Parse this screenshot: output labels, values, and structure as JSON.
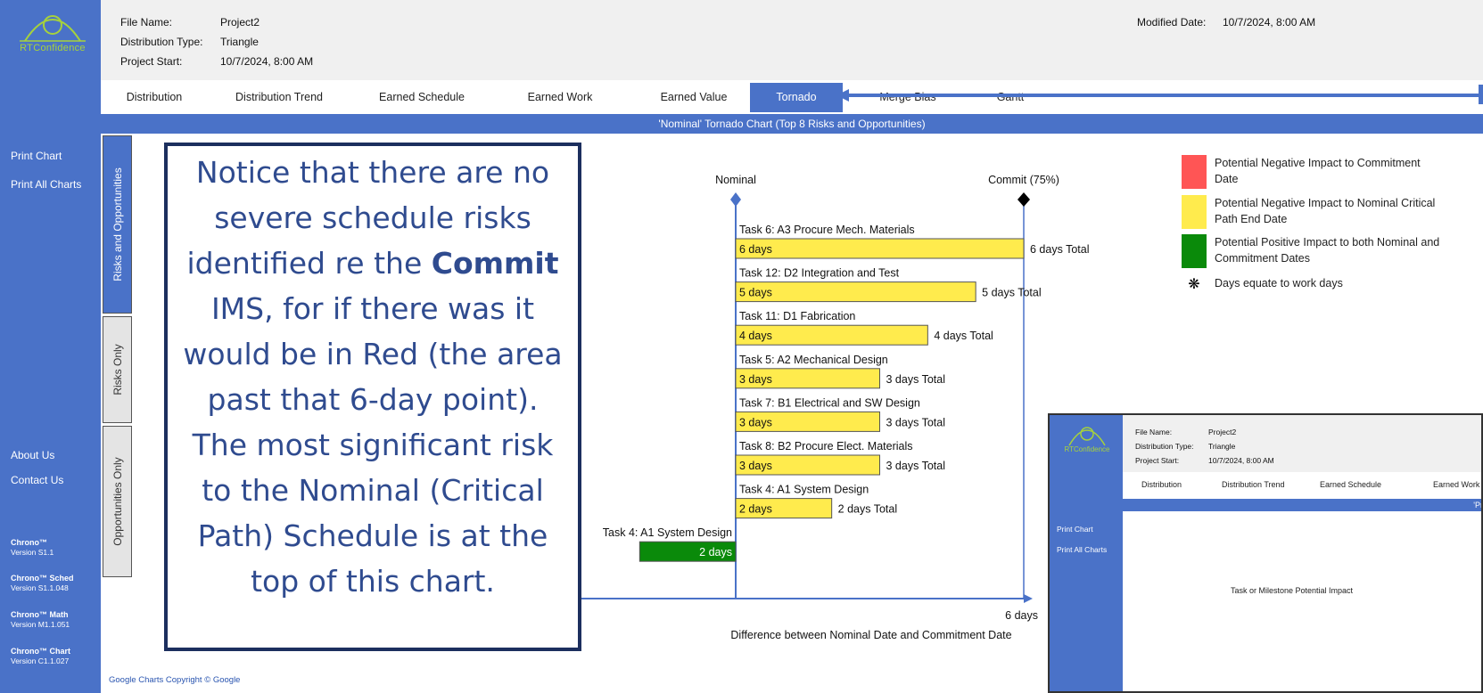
{
  "app": {
    "logo_text": "RTConfidence"
  },
  "sidebar": {
    "links": [
      "Print Chart",
      "Print All Charts",
      "About Us",
      "Contact Us"
    ],
    "versions": [
      {
        "name": "Chrono™",
        "version": "Version S1.1"
      },
      {
        "name": "Chrono™ Sched",
        "version": "Version S1.1.048"
      },
      {
        "name": "Chrono™ Math",
        "version": "Version M1.1.051"
      },
      {
        "name": "Chrono™ Chart",
        "version": "Version C1.1.027"
      }
    ]
  },
  "info": {
    "file_name_label": "File Name:",
    "file_name": "Project2",
    "dist_type_label": "Distribution Type:",
    "dist_type": "Triangle",
    "project_start_label": "Project Start:",
    "project_start": "10/7/2024, 8:00 AM",
    "modified_label": "Modified Date:",
    "modified": "10/7/2024, 8:00 AM"
  },
  "tabs": [
    "Distribution",
    "Distribution Trend",
    "Earned Schedule",
    "Earned Work",
    "Earned Value",
    "Tornado",
    "Merge Bias",
    "Gantt"
  ],
  "active_tab": "Tornado",
  "chart_title": "'Nominal' Tornado Chart (Top 8 Risks and Opportunities)",
  "vertical_tabs": [
    "Risks and Opportunities",
    "Risks Only",
    "Opportunities Only"
  ],
  "colors": {
    "accent": "#4a72c8",
    "negative_commit": "#ff5555",
    "negative_nominal": "#ffeb4d",
    "positive": "#0a8a0a"
  },
  "legend": [
    {
      "text": "Potential Negative Impact to Commitment Date"
    },
    {
      "text": "Potential Negative Impact to Nominal Critical Path End Date"
    },
    {
      "text": "Potential Positive Impact to both Nominal and Commitment Dates"
    },
    {
      "text": "Days equate to work days"
    }
  ],
  "chart_data": {
    "type": "bar",
    "orientation": "horizontal",
    "nominal_label": "Nominal",
    "commit_label": "Commit (75%)",
    "commit_days": 6,
    "axis_end_label": "6 days",
    "xlabel": "Difference between Nominal Date and Commitment Date",
    "risks": [
      {
        "task": "Task 6: A3 Procure Mech. Materials",
        "days": 6,
        "label": "6 days",
        "total": "6 days Total"
      },
      {
        "task": "Task 12: D2 Integration and Test",
        "days": 5,
        "label": "5 days",
        "total": "5 days Total"
      },
      {
        "task": "Task 11: D1 Fabrication",
        "days": 4,
        "label": "4 days",
        "total": "4 days Total"
      },
      {
        "task": "Task 5: A2 Mechanical Design",
        "days": 3,
        "label": "3 days",
        "total": "3 days Total"
      },
      {
        "task": "Task 7: B1 Electrical and SW Design",
        "days": 3,
        "label": "3 days",
        "total": "3 days Total"
      },
      {
        "task": "Task 8: B2 Procure Elect. Materials",
        "days": 3,
        "label": "3 days",
        "total": "3 days Total"
      },
      {
        "task": "Task 4: A1 System Design",
        "days": 2,
        "label": "2 days",
        "total": "2 days Total"
      }
    ],
    "opportunities": [
      {
        "task": "Task 4: A1 System Design",
        "days": 2,
        "label": "2 days"
      }
    ]
  },
  "footer": "Google Charts Copyright © Google",
  "callout": {
    "before_bold": "Notice that there are no severe schedule risks identified re the ",
    "bold": "Commit",
    "after_bold": " IMS, for if there was it would be in Red (the area past that 6-day point).  The most significant risk to the Nominal (Critical Path) Schedule is at the top of this chart."
  },
  "mini": {
    "logo_text": "RTConfidence",
    "file_name_label": "File Name:",
    "file_name": "Project2",
    "dist_type_label": "Distribution Type:",
    "dist_type": "Triangle",
    "project_start_label": "Project Start:",
    "project_start": "10/7/2024, 8:00 AM",
    "tabs": [
      "Distribution",
      "Distribution Trend",
      "Earned Schedule",
      "Earned Work"
    ],
    "links": [
      "Print Chart",
      "Print All Charts"
    ],
    "title_fragment": "'Pr",
    "center_text": "Task or Milestone Potential Impact"
  }
}
